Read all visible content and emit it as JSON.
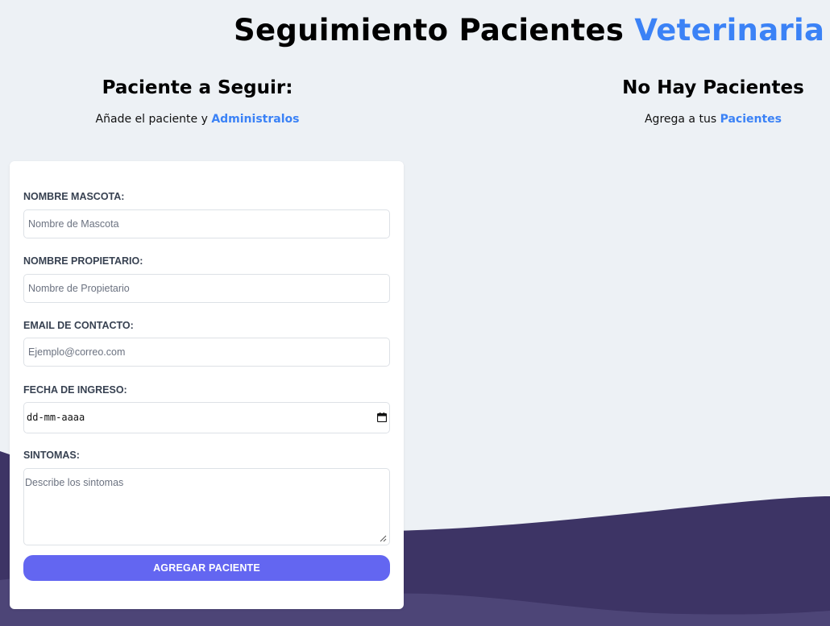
{
  "header": {
    "title_main": "Seguimiento Pacientes",
    "title_accent": "Veterinaria"
  },
  "form_section": {
    "heading": "Paciente a Seguir:",
    "subtitle_text": "Añade el paciente y",
    "subtitle_accent": "Administralos"
  },
  "list_section": {
    "heading": "No Hay Pacientes",
    "subtitle_text": "Agrega a tus",
    "subtitle_accent": "Pacientes"
  },
  "form": {
    "pet_name": {
      "label": "NOMBRE MASCOTA:",
      "placeholder": "Nombre de Mascota",
      "value": ""
    },
    "owner_name": {
      "label": "NOMBRE PROPIETARIO:",
      "placeholder": "Nombre de Propietario",
      "value": ""
    },
    "email": {
      "label": "EMAIL DE CONTACTO:",
      "placeholder": "Ejemplo@correo.com",
      "value": ""
    },
    "date": {
      "label": "FECHA DE INGRESO:",
      "display": "dd-mm-aaaa",
      "icon": "calendar-icon"
    },
    "symptoms": {
      "label": "SINTOMAS:",
      "placeholder": "Describe los sintomas",
      "value": ""
    },
    "submit_label": "AGREGAR PACIENTE"
  },
  "colors": {
    "accent": "#3b82f6",
    "button": "#6366f1",
    "background": "#edf1f5",
    "wave_dark": "#3d3465",
    "wave_light": "#4d4577"
  }
}
